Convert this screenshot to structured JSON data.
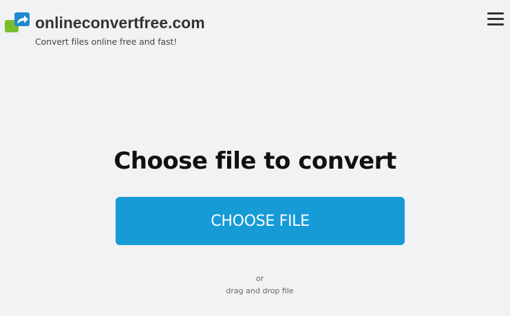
{
  "header": {
    "site_name": "onlineconvertfree.com",
    "tagline": "Convert files online free and fast!",
    "logo_icon": "convert-arrow-icon",
    "menu_icon": "hamburger-menu-icon"
  },
  "main": {
    "heading": "Choose file to convert",
    "choose_button_label": "CHOOSE FILE",
    "or_text": "or",
    "drag_drop_text": "drag and drop file"
  },
  "colors": {
    "background": "#f1f2f4",
    "primary_button": "#169bd7",
    "logo_green": "#7cbd2b",
    "logo_blue": "#1d8ad0"
  }
}
